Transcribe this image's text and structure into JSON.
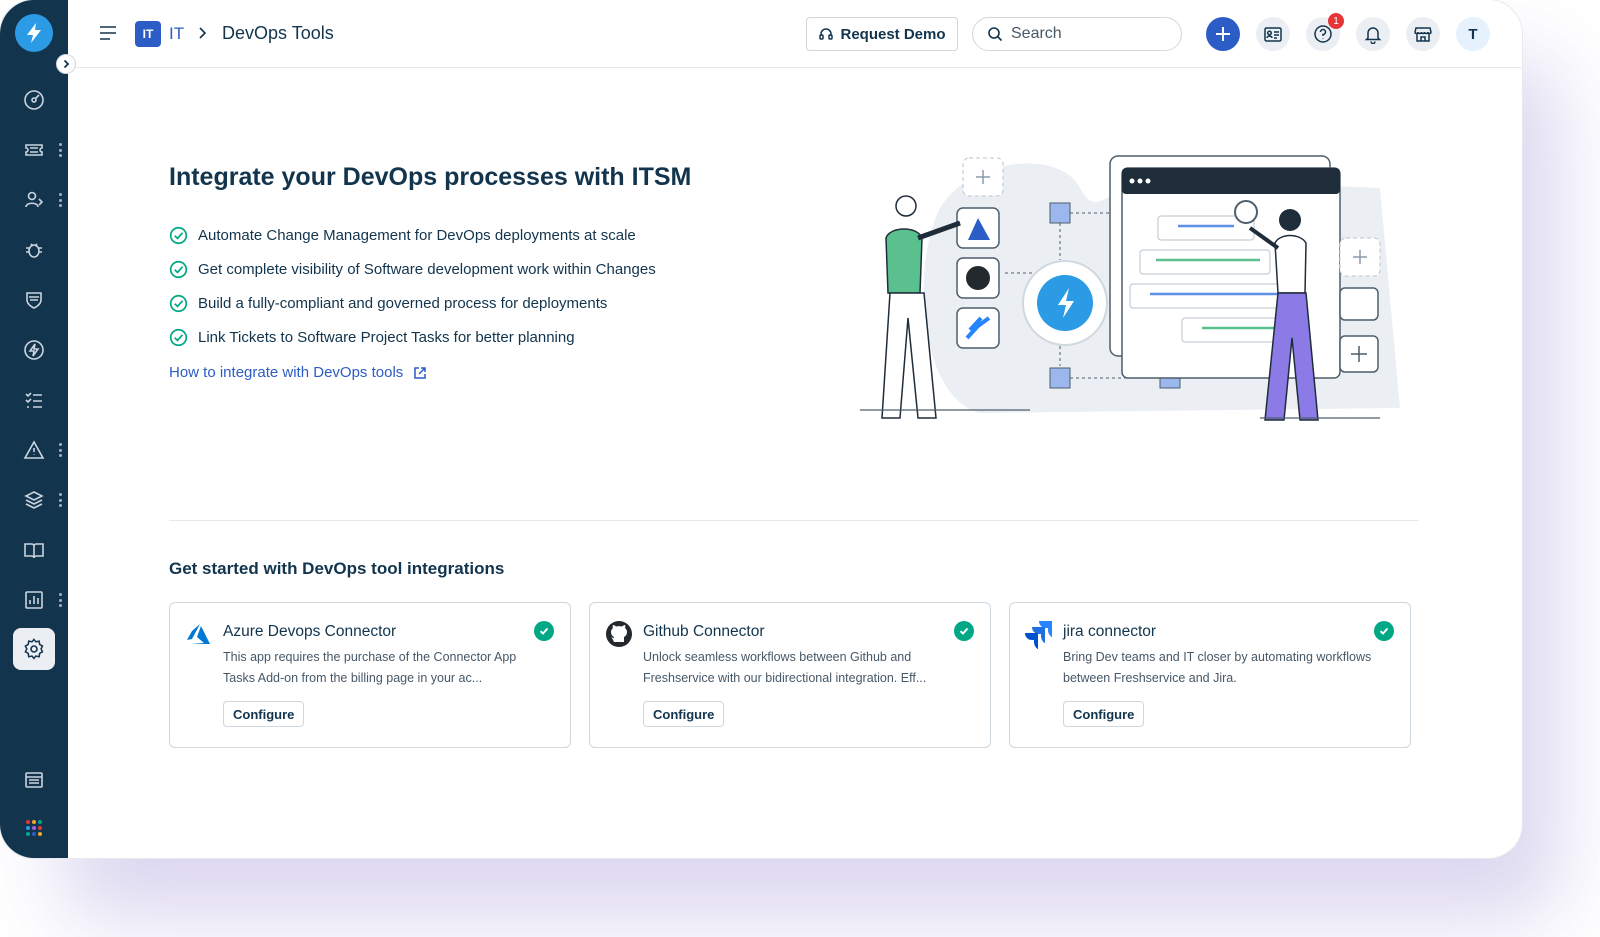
{
  "header": {
    "workspace_badge": "IT",
    "breadcrumb_workspace": "IT",
    "page_title": "DevOps Tools",
    "request_demo_label": "Request Demo",
    "search_placeholder": "Search",
    "help_badge_count": "1",
    "avatar_initial": "T"
  },
  "sidebar": {
    "items": [
      {
        "icon": "dashboard-icon"
      },
      {
        "icon": "ticket-icon"
      },
      {
        "icon": "users-icon"
      },
      {
        "icon": "bug-icon"
      },
      {
        "icon": "shield-icon"
      },
      {
        "icon": "bolt-icon"
      },
      {
        "icon": "tasks-icon"
      },
      {
        "icon": "alert-icon"
      },
      {
        "icon": "layers-icon"
      },
      {
        "icon": "book-icon"
      },
      {
        "icon": "reports-icon"
      },
      {
        "icon": "settings-icon",
        "active": true
      },
      {
        "icon": "catalog-icon"
      },
      {
        "icon": "apps-grid-icon"
      }
    ]
  },
  "hero": {
    "title": "Integrate your DevOps processes with ITSM",
    "bullets": [
      "Automate Change Management for DevOps deployments at scale",
      "Get complete visibility of Software development work within Changes",
      "Build a fully-compliant and governed process for deployments",
      "Link Tickets to Software Project Tasks for better planning"
    ],
    "link_label": "How to integrate with DevOps tools"
  },
  "integrations": {
    "section_title": "Get started with DevOps tool integrations",
    "cards": [
      {
        "icon": "azure-devops-icon",
        "title": "Azure Devops Connector",
        "description": "This app requires the purchase of the Connector App Tasks Add-on from the billing page in your ac...",
        "button_label": "Configure",
        "installed": true
      },
      {
        "icon": "github-icon",
        "title": "Github Connector",
        "description": "Unlock seamless workflows between Github and Freshservice with our bidirectional integration. Eff...",
        "button_label": "Configure",
        "installed": true
      },
      {
        "icon": "jira-icon",
        "title": "jira connector",
        "description": "Bring Dev teams and IT closer by automating workflows between Freshservice and Jira.",
        "button_label": "Configure",
        "installed": true
      }
    ]
  },
  "colors": {
    "sidebar_bg": "#12344d",
    "accent_blue": "#2c5cc5",
    "success_green": "#00a886",
    "brand_blue": "#2c9be5",
    "alert_red": "#e43538"
  }
}
